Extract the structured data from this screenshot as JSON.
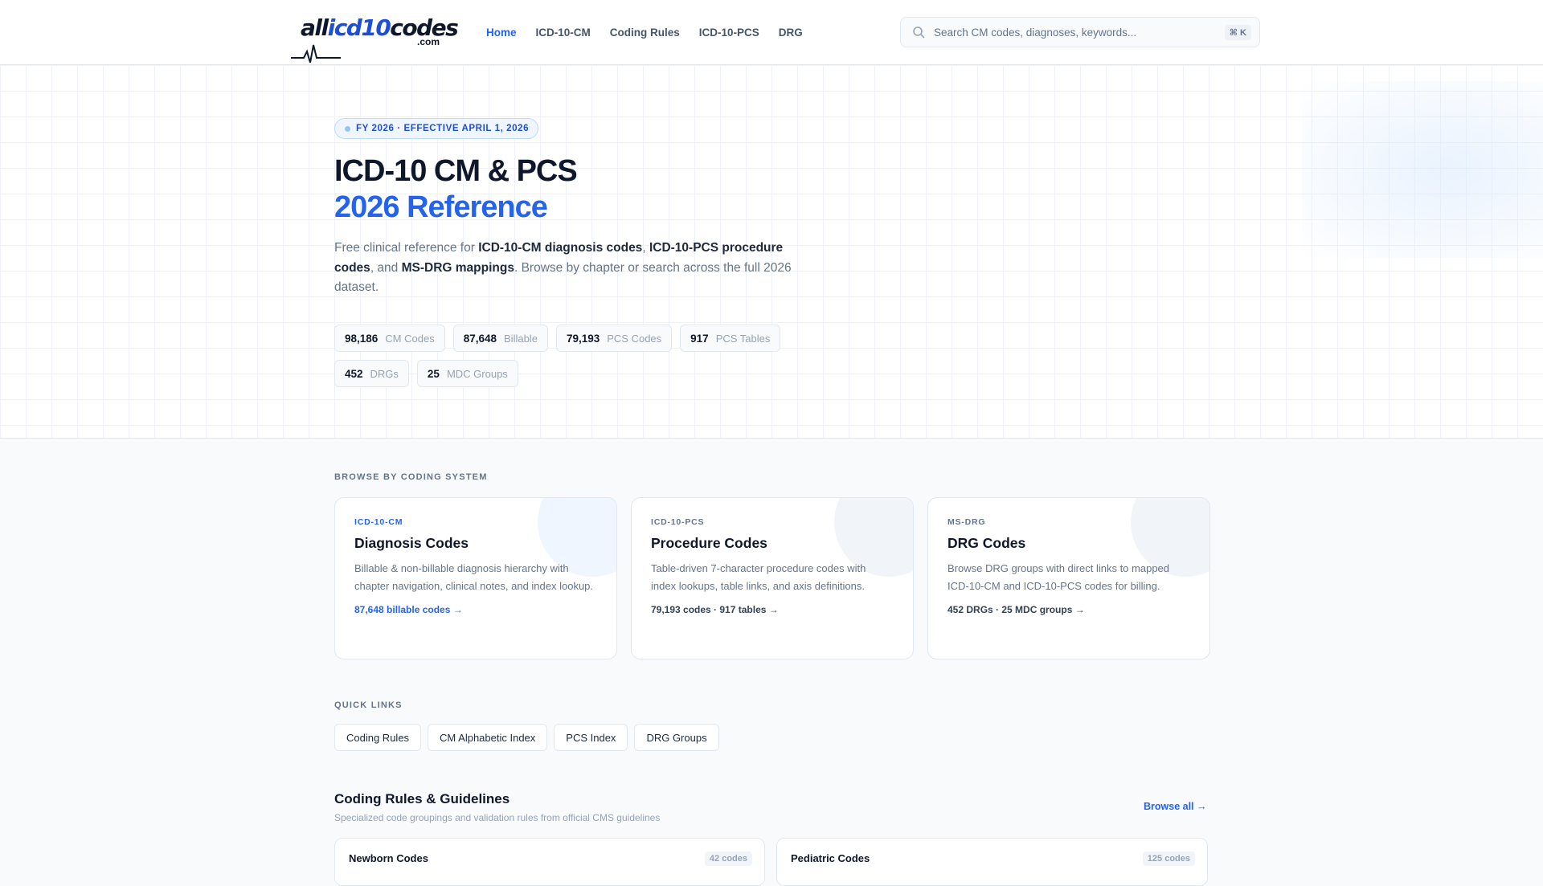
{
  "header": {
    "logo": {
      "part1": "all",
      "part2": "icd10",
      "part3": "codes",
      "suffix": ".com"
    },
    "nav": [
      "Home",
      "ICD-10-CM",
      "Coding Rules",
      "ICD-10-PCS",
      "DRG"
    ],
    "search": {
      "placeholder": "Search CM codes, diagnoses, keywords...",
      "shortcut": "⌘ K",
      "icon": "search-icon"
    }
  },
  "hero": {
    "badge": "FY 2026 · EFFECTIVE APRIL 1, 2026",
    "title_line1": "ICD-10 CM & PCS",
    "title_line2": "2026 Reference",
    "desc": {
      "t1": "Free clinical reference for ",
      "b1": "ICD-10-CM diagnosis codes",
      "t2": ", ",
      "b2": "ICD-10-PCS procedure codes",
      "t3": ", and ",
      "b3": "MS-DRG mappings",
      "t4": ". Browse by chapter or search across the full 2026 dataset."
    },
    "stats": [
      {
        "num": "98,186",
        "label": "CM Codes"
      },
      {
        "num": "87,648",
        "label": "Billable"
      },
      {
        "num": "79,193",
        "label": "PCS Codes"
      },
      {
        "num": "917",
        "label": "PCS Tables"
      },
      {
        "num": "452",
        "label": "DRGs"
      },
      {
        "num": "25",
        "label": "MDC Groups"
      }
    ]
  },
  "browse": {
    "label": "BROWSE BY CODING SYSTEM",
    "cards": [
      {
        "tag": "ICD-10-CM",
        "title": "Diagnosis Codes",
        "desc": "Billable & non-billable diagnosis hierarchy with chapter navigation, clinical notes, and index lookup.",
        "link": "87,648 billable codes →"
      },
      {
        "tag": "ICD-10-PCS",
        "title": "Procedure Codes",
        "desc": "Table-driven 7-character procedure codes with index lookups, table links, and axis definitions.",
        "link": "79,193 codes · 917 tables →"
      },
      {
        "tag": "MS-DRG",
        "title": "DRG Codes",
        "desc": "Browse DRG groups with direct links to mapped ICD-10-CM and ICD-10-PCS codes for billing.",
        "link": "452 DRGs · 25 MDC groups →"
      }
    ]
  },
  "quick_links": {
    "label": "QUICK LINKS",
    "items": [
      "Coding Rules",
      "CM Alphabetic Index",
      "PCS Index",
      "DRG Groups"
    ]
  },
  "rules": {
    "title": "Coding Rules & Guidelines",
    "subtitle": "Specialized code groupings and validation rules from official CMS guidelines",
    "browse_all": "Browse all →",
    "items": [
      {
        "name": "Newborn Codes",
        "count": "42 codes"
      },
      {
        "name": "Pediatric Codes",
        "count": "125 codes"
      }
    ]
  },
  "colors": {
    "accent": "#2563eb",
    "text": "#0f172a",
    "muted": "#64748b",
    "border": "#e2e8f0"
  }
}
